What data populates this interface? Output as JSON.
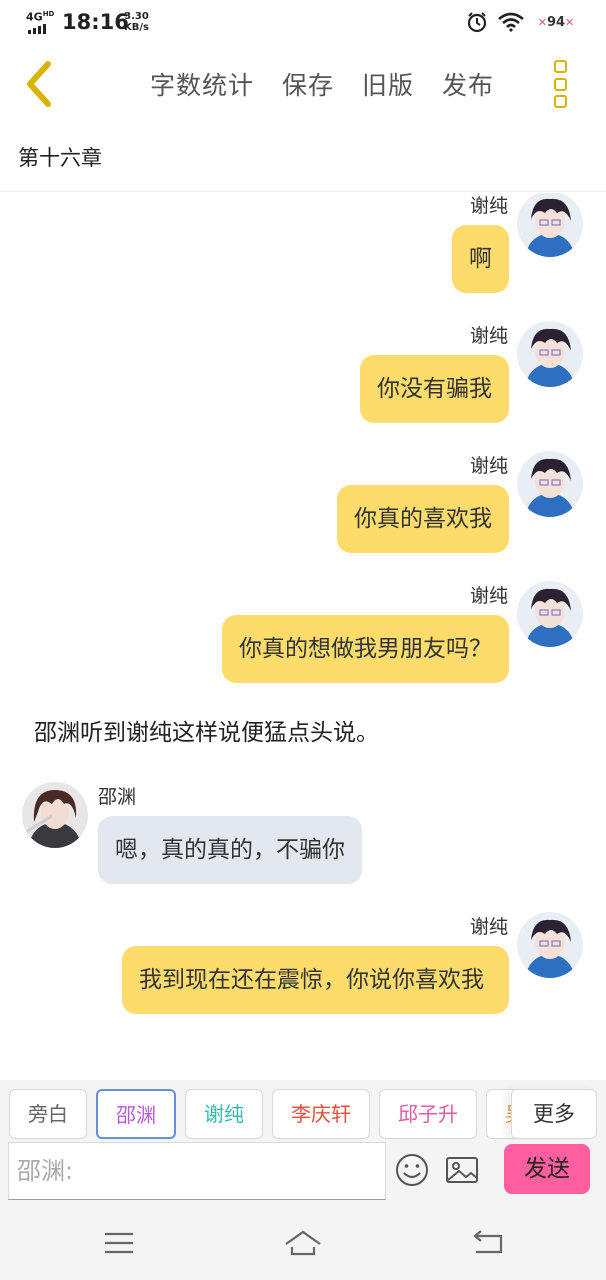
{
  "status_bar": {
    "network": "4G",
    "network_sup": "HD",
    "time": "18:16",
    "speed_value": "3.30",
    "speed_unit": "KB/s",
    "battery": "94"
  },
  "toolbar": {
    "actions": [
      "字数统计",
      "保存",
      "旧版",
      "发布"
    ],
    "accent_color": "#d7b400"
  },
  "chapter": {
    "title": "第十六章"
  },
  "messages": [
    {
      "type": "right",
      "sender": "谢纯",
      "text": "啊"
    },
    {
      "type": "right",
      "sender": "谢纯",
      "text": "你没有骗我"
    },
    {
      "type": "right",
      "sender": "谢纯",
      "text": "你真的喜欢我"
    },
    {
      "type": "right",
      "sender": "谢纯",
      "text": "你真的想做我男朋友吗？"
    },
    {
      "type": "narration",
      "text": "邵渊听到谢纯这样说便猛点头说。"
    },
    {
      "type": "left",
      "sender": "邵渊",
      "text": "嗯，真的真的，不骗你"
    },
    {
      "type": "right",
      "sender": "谢纯",
      "text": "我到现在还在震惊，你说你喜欢我"
    }
  ],
  "characters": [
    {
      "name": "旁白",
      "color": "#666666"
    },
    {
      "name": "邵渊",
      "color": "#b45cd6"
    },
    {
      "name": "谢纯",
      "color": "#3bb8b3"
    },
    {
      "name": "李庆轩",
      "color": "#e0503c"
    },
    {
      "name": "邱子升",
      "color": "#e05aa8"
    },
    {
      "name": "吴",
      "color": "#e8a04a"
    }
  ],
  "more_characters_label": "更多",
  "composer": {
    "placeholder": "邵渊:",
    "send_label": "发送",
    "send_color": "#ff5f9e"
  },
  "colors": {
    "bubble_right": "#fddc6c",
    "bubble_left": "#e3e8ef"
  }
}
